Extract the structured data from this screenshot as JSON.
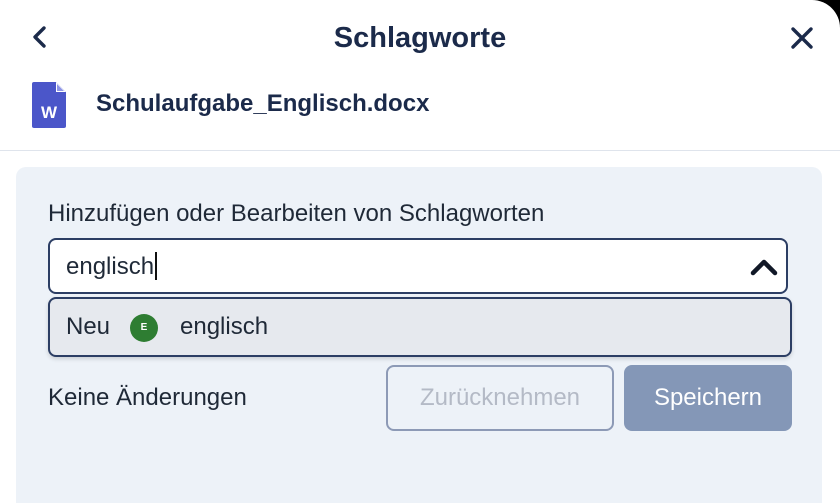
{
  "header": {
    "title": "Schlagworte",
    "back_icon": "chevron-left-icon",
    "close_icon": "close-icon"
  },
  "file": {
    "name": "Schulaufgabe_Englisch.docx",
    "icon": "word-document-icon",
    "icon_letter": "W",
    "icon_color": "#4b56c9"
  },
  "tags": {
    "label": "Hinzufügen oder Bearbeiten von Schlagworten",
    "input_value": "englisch",
    "toggle_icon": "chevron-up-icon",
    "suggestion": {
      "prefix": "Neu",
      "badge_letter": "E",
      "badge_color": "#2e7d32",
      "text": "englisch"
    }
  },
  "footer": {
    "status": "Keine Änderungen",
    "revert_label": "Zurücknehmen",
    "save_label": "Speichern"
  }
}
